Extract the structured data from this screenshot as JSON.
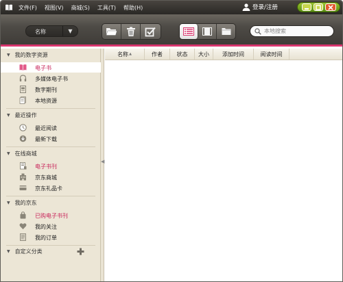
{
  "menu": [
    {
      "label": "文件(F)"
    },
    {
      "label": "视图(V)"
    },
    {
      "label": "商城(S)"
    },
    {
      "label": "工具(T)"
    },
    {
      "label": "帮助(H)"
    }
  ],
  "login": {
    "label": "登录/注册"
  },
  "toolbar": {
    "sort_label": "名称",
    "search_placeholder": "本地搜索"
  },
  "sidebar": {
    "sections": [
      {
        "title": "我的数字资源",
        "items": [
          {
            "label": "电子书",
            "icon": "book-icon",
            "selected": true,
            "pink": true
          },
          {
            "label": "多媒体电子书",
            "icon": "headphones-icon"
          },
          {
            "label": "数字期刊",
            "icon": "magazine-icon"
          },
          {
            "label": "本地资源",
            "icon": "local-files-icon"
          }
        ]
      },
      {
        "title": "最近操作",
        "items": [
          {
            "label": "最近阅读",
            "icon": "clock-icon"
          },
          {
            "label": "最新下载",
            "icon": "download-icon"
          }
        ]
      },
      {
        "title": "在线商城",
        "items": [
          {
            "label": "电子书刊",
            "icon": "ebook-store-icon",
            "pink": true
          },
          {
            "label": "京东商城",
            "icon": "building-icon"
          },
          {
            "label": "京东礼品卡",
            "icon": "card-icon"
          }
        ]
      },
      {
        "title": "我的京东",
        "items": [
          {
            "label": "已购电子书刊",
            "icon": "bag-icon",
            "pink": true
          },
          {
            "label": "我的关注",
            "icon": "heart-icon"
          },
          {
            "label": "我的订单",
            "icon": "order-icon"
          }
        ]
      },
      {
        "title": "自定义分类",
        "items": []
      }
    ]
  },
  "table": {
    "columns": [
      "名称",
      "作者",
      "状态",
      "大小",
      "添加时间",
      "阅读时间"
    ]
  },
  "colors": {
    "accent": "#d9356e",
    "selected_text": "#c8245a",
    "sidebar_bg": "#ece6d6"
  }
}
